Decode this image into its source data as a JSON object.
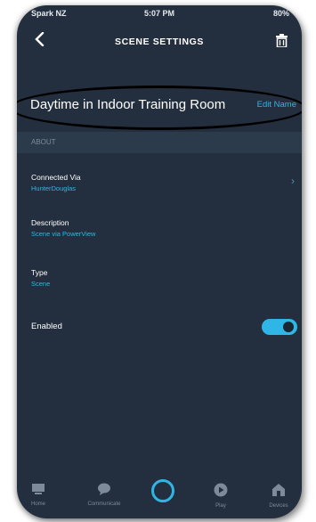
{
  "status_bar": {
    "carrier": "Spark NZ",
    "time": "5:07 PM",
    "battery": "80%"
  },
  "header": {
    "title": "SCENE SETTINGS",
    "back_icon": "chevron-left-icon",
    "delete_icon": "trash-icon"
  },
  "scene": {
    "name": "Daytime in Indoor Training Room",
    "edit_label": "Edit Name"
  },
  "about": {
    "section_label": "ABOUT",
    "connected_via": {
      "label": "Connected Via",
      "value": "HunterDouglas"
    },
    "description": {
      "label": "Description",
      "value": "Scene via PowerView"
    },
    "type": {
      "label": "Type",
      "value": "Scene"
    },
    "enabled": {
      "label": "Enabled",
      "on": true
    }
  },
  "tabbar": {
    "items": [
      {
        "label": "Home",
        "icon": "home-icon"
      },
      {
        "label": "Communicate",
        "icon": "chat-icon"
      },
      {
        "label": "",
        "icon": "alexa-icon"
      },
      {
        "label": "Play",
        "icon": "play-icon"
      },
      {
        "label": "Devices",
        "icon": "devices-icon"
      }
    ]
  },
  "colors": {
    "background": "#232f3e",
    "accent": "#2fb6e6",
    "band": "#2c3b4c",
    "muted": "#7d8a9a"
  }
}
